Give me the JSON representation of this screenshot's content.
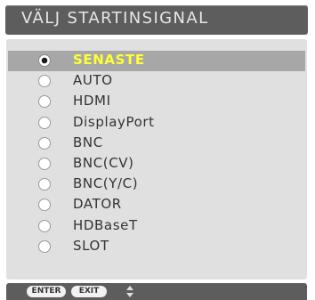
{
  "window": {
    "title": "VÄLJ STARTINSIGNAL"
  },
  "options": [
    {
      "label": "SENASTE",
      "selected": true
    },
    {
      "label": "AUTO",
      "selected": false
    },
    {
      "label": "HDMI",
      "selected": false
    },
    {
      "label": "DisplayPort",
      "selected": false
    },
    {
      "label": "BNC",
      "selected": false
    },
    {
      "label": "BNC(CV)",
      "selected": false
    },
    {
      "label": "BNC(Y/C)",
      "selected": false
    },
    {
      "label": "DATOR",
      "selected": false
    },
    {
      "label": "HDBaseT",
      "selected": false
    },
    {
      "label": "SLOT",
      "selected": false
    }
  ],
  "footer": {
    "enter_label": "ENTER",
    "exit_label": "EXIT",
    "nav_icon": "up-down-arrows-icon"
  },
  "colors": {
    "title_bar": "#5d5d5d",
    "panel": "#e0e0e0",
    "selected_row": "#a7a7a7",
    "selected_text": "#ffff33",
    "text": "#333333"
  }
}
